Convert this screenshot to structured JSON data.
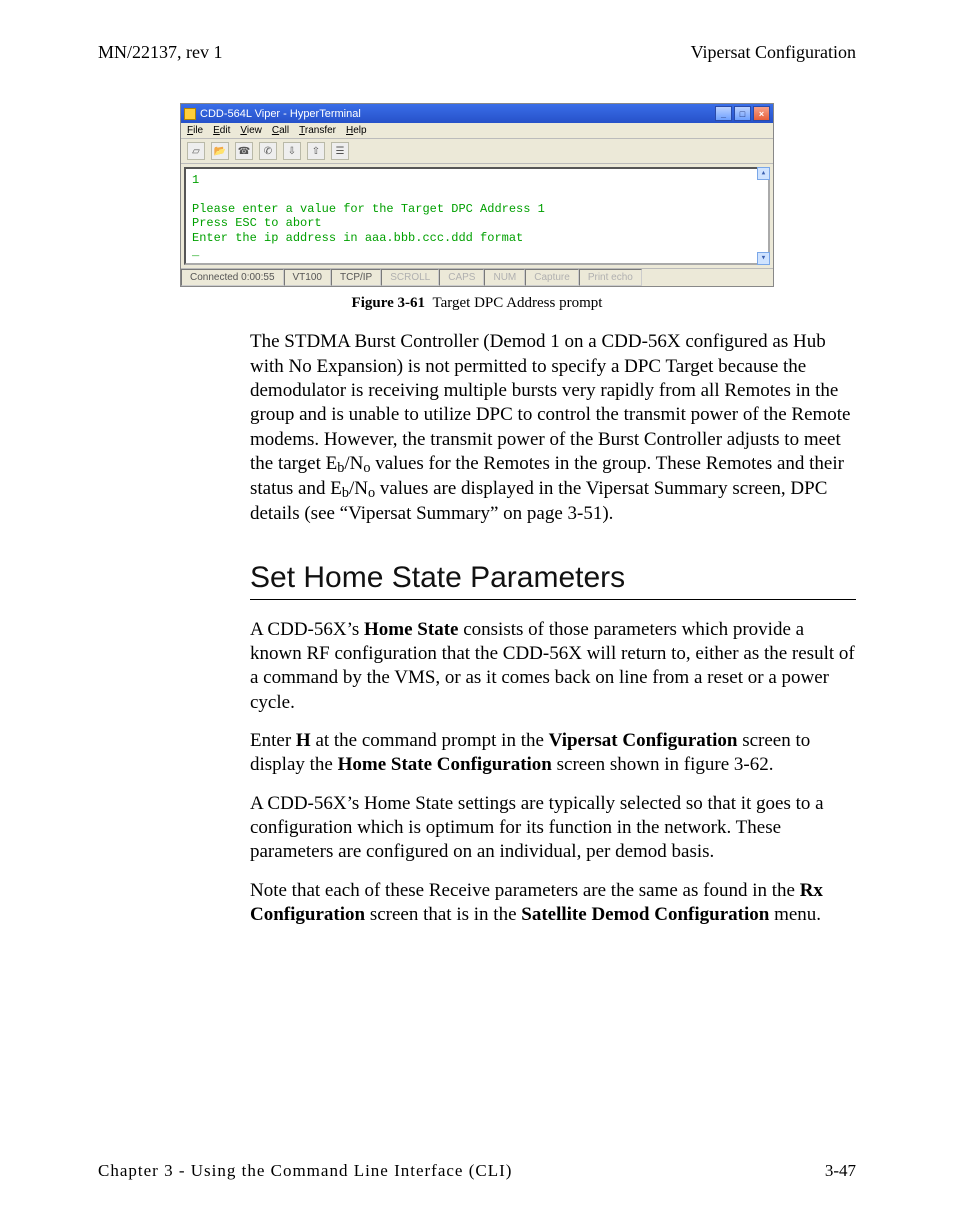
{
  "header": {
    "left": "MN/22137, rev 1",
    "right": "Vipersat Configuration"
  },
  "hyperterm": {
    "title": "CDD-564L Viper - HyperTerminal",
    "menus": {
      "file": "File",
      "edit": "Edit",
      "view": "View",
      "call": "Call",
      "transfer": "Transfer",
      "help": "Help"
    },
    "terminal_text": "1\n\nPlease enter a value for the Target DPC Address 1\nPress ESC to abort\nEnter the ip address in aaa.bbb.ccc.ddd format\n_",
    "status": {
      "connected": "Connected 0:00:55",
      "emulation": "VT100",
      "transport": "TCP/IP",
      "scroll": "SCROLL",
      "caps": "CAPS",
      "num": "NUM",
      "capture": "Capture",
      "printecho": "Print echo"
    }
  },
  "figure61": {
    "label": "Figure 3-61",
    "caption": "Target DPC Address prompt"
  },
  "para1": {
    "t1": "The STDMA Burst Controller (Demod 1 on a CDD-56X configured as Hub with No Expansion) is not permitted to specify a DPC Target because the demodulator is receiving multiple bursts very rapidly from all Remotes in the group and is unable to utilize DPC to control the transmit power of the Remote modems. However, the transmit power of the Burst Controller adjusts to meet the target E",
    "t2": "/N",
    "t3": " values for the Remotes in the group. These Remotes and their status and E",
    "t4": "/N",
    "t5": " values are displayed in the Vipersat Summary screen, DPC details (see “Vipersat Summary” on page 3-51).",
    "sub_b": "b",
    "sub_o": "o"
  },
  "heading": "Set Home State Parameters",
  "para2": {
    "a": "A CDD-56X’s ",
    "b": "Home State",
    "c": " consists of those parameters which provide a known RF configuration that the CDD-56X will return to, either as the result of a command by the VMS, or as it comes back on line from a reset or a power cycle."
  },
  "para3": {
    "a": "Enter ",
    "b": "H",
    "c": " at the command prompt in the ",
    "d": "Vipersat Configuration",
    "e": " screen to display the ",
    "f": "Home State Configuration",
    "g": " screen shown in figure 3-62."
  },
  "para4": "A CDD-56X’s Home State settings are typically selected so that it goes to a configuration which is optimum for its function in the network. These parameters are configured on an individual, per demod basis.",
  "para5": {
    "a": "Note that each of these Receive parameters are the same as found in the ",
    "b": "Rx Configuration",
    "c": " screen that is in the ",
    "d": "Satellite Demod Configuration",
    "e": " menu."
  },
  "footer": {
    "chapter": "Chapter 3 - Using the Command Line Interface (CLI)",
    "page": "3-47"
  }
}
